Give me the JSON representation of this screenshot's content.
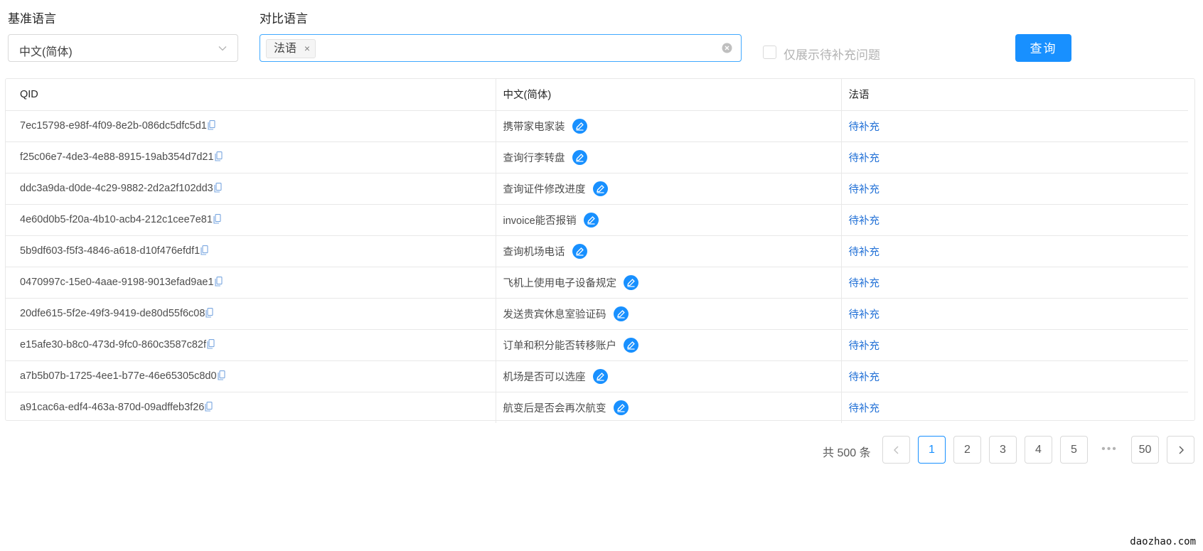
{
  "filters": {
    "base_language_label": "基准语言",
    "base_language_value": "中文(简体)",
    "compare_language_label": "对比语言",
    "compare_language_tag": "法语",
    "compare_tag_close": "×",
    "only_pending_label": "仅展示待补充问题",
    "query_button": "查询"
  },
  "table": {
    "headers": [
      "QID",
      "中文(简体)",
      "法语"
    ],
    "rows": [
      {
        "qid": "7ec15798-e98f-4f09-8e2b-086dc5dfc5d1",
        "zh": "携带家电家装",
        "fr": "待补充"
      },
      {
        "qid": "f25c06e7-4de3-4e88-8915-19ab354d7d21",
        "zh": "查询行李转盘",
        "fr": "待补充"
      },
      {
        "qid": "ddc3a9da-d0de-4c29-9882-2d2a2f102dd3",
        "zh": "查询证件修改进度",
        "fr": "待补充"
      },
      {
        "qid": "4e60d0b5-f20a-4b10-acb4-212c1cee7e81",
        "zh": "invoice能否报销",
        "fr": "待补充"
      },
      {
        "qid": "5b9df603-f5f3-4846-a618-d10f476efdf1",
        "zh": "查询机场电话",
        "fr": "待补充"
      },
      {
        "qid": "0470997c-15e0-4aae-9198-9013efad9ae1",
        "zh": "飞机上使用电子设备规定",
        "fr": "待补充"
      },
      {
        "qid": "20dfe615-5f2e-49f3-9419-de80d55f6c08",
        "zh": "发送贵宾休息室验证码",
        "fr": "待补充"
      },
      {
        "qid": "e15afe30-b8c0-473d-9fc0-860c3587c82f",
        "zh": "订单和积分能否转移账户",
        "fr": "待补充"
      },
      {
        "qid": "a7b5b07b-1725-4ee1-b77e-46e65305c8d0",
        "zh": "机场是否可以选座",
        "fr": "待补充"
      },
      {
        "qid": "a91cac6a-edf4-463a-870d-09adffeb3f26",
        "zh": "航变后是否会再次航变",
        "fr": "待补充"
      }
    ]
  },
  "pagination": {
    "total": "共 500 条",
    "pages": [
      "1",
      "2",
      "3",
      "4",
      "5"
    ],
    "ellipsis": "•••",
    "last_page": "50",
    "current_page": 1
  },
  "watermark": "daozhao.com",
  "colors": {
    "primary": "#1890ff",
    "link": "#1f6fd6",
    "border": "#e8e8e8"
  },
  "icons": [
    "chevron-down-icon",
    "clear-icon",
    "copy-icon",
    "edit-icon",
    "chevron-left-icon",
    "chevron-right-icon"
  ]
}
